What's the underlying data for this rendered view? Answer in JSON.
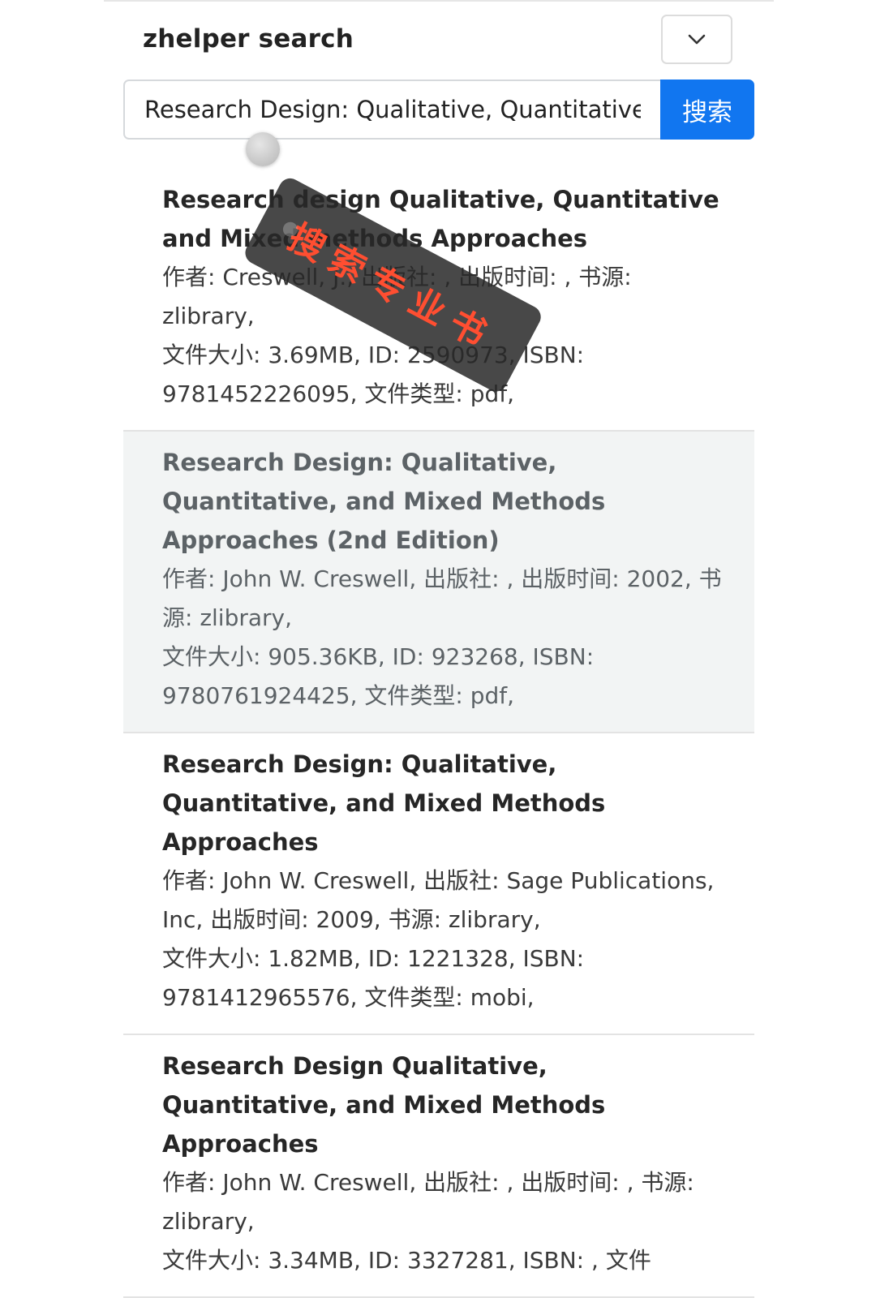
{
  "header": {
    "title": "zhelper search"
  },
  "search": {
    "value": "Research Design: Qualitative, Quantitative,",
    "button_label": "搜索"
  },
  "results": [
    {
      "title": "Research design Qualitative, Quantitative and Mixed methods Approaches",
      "author_line": "作者: Creswell, J., 出版社: , 出版时间: , 书源: zlibrary,",
      "file_line": "文件大小: 3.69MB, ID: 2590973, ISBN: 9781452226095, 文件类型: pdf,"
    },
    {
      "title": "Research Design: Qualitative, Quantitative, and Mixed Methods Approaches (2nd Edition)",
      "author_line": "作者: John W. Creswell, 出版社: , 出版时间: 2002, 书源: zlibrary,",
      "file_line": "文件大小: 905.36KB, ID: 923268, ISBN: 9780761924425, 文件类型: pdf,"
    },
    {
      "title": "Research Design: Qualitative, Quantitative, and Mixed Methods Approaches",
      "author_line": "作者: John W. Creswell, 出版社: Sage Publications, Inc, 出版时间: 2009, 书源: zlibrary,",
      "file_line": "文件大小: 1.82MB, ID: 1221328, ISBN: 9781412965576, 文件类型: mobi,"
    },
    {
      "title": "Research Design Qualitative, Quantitative, and Mixed Methods Approaches",
      "author_line": "作者: John W. Creswell, 出版社: , 出版时间: , 书源: zlibrary,",
      "file_line": "文件大小: 3.34MB, ID: 3327281, ISBN: , 文件"
    }
  ],
  "overlay": {
    "tag_text": "搜索专业书"
  },
  "icons": {
    "dropdown": "chevron-down-icon"
  },
  "colors": {
    "accent": "#1176f0",
    "tag_text": "#ff4e31"
  }
}
